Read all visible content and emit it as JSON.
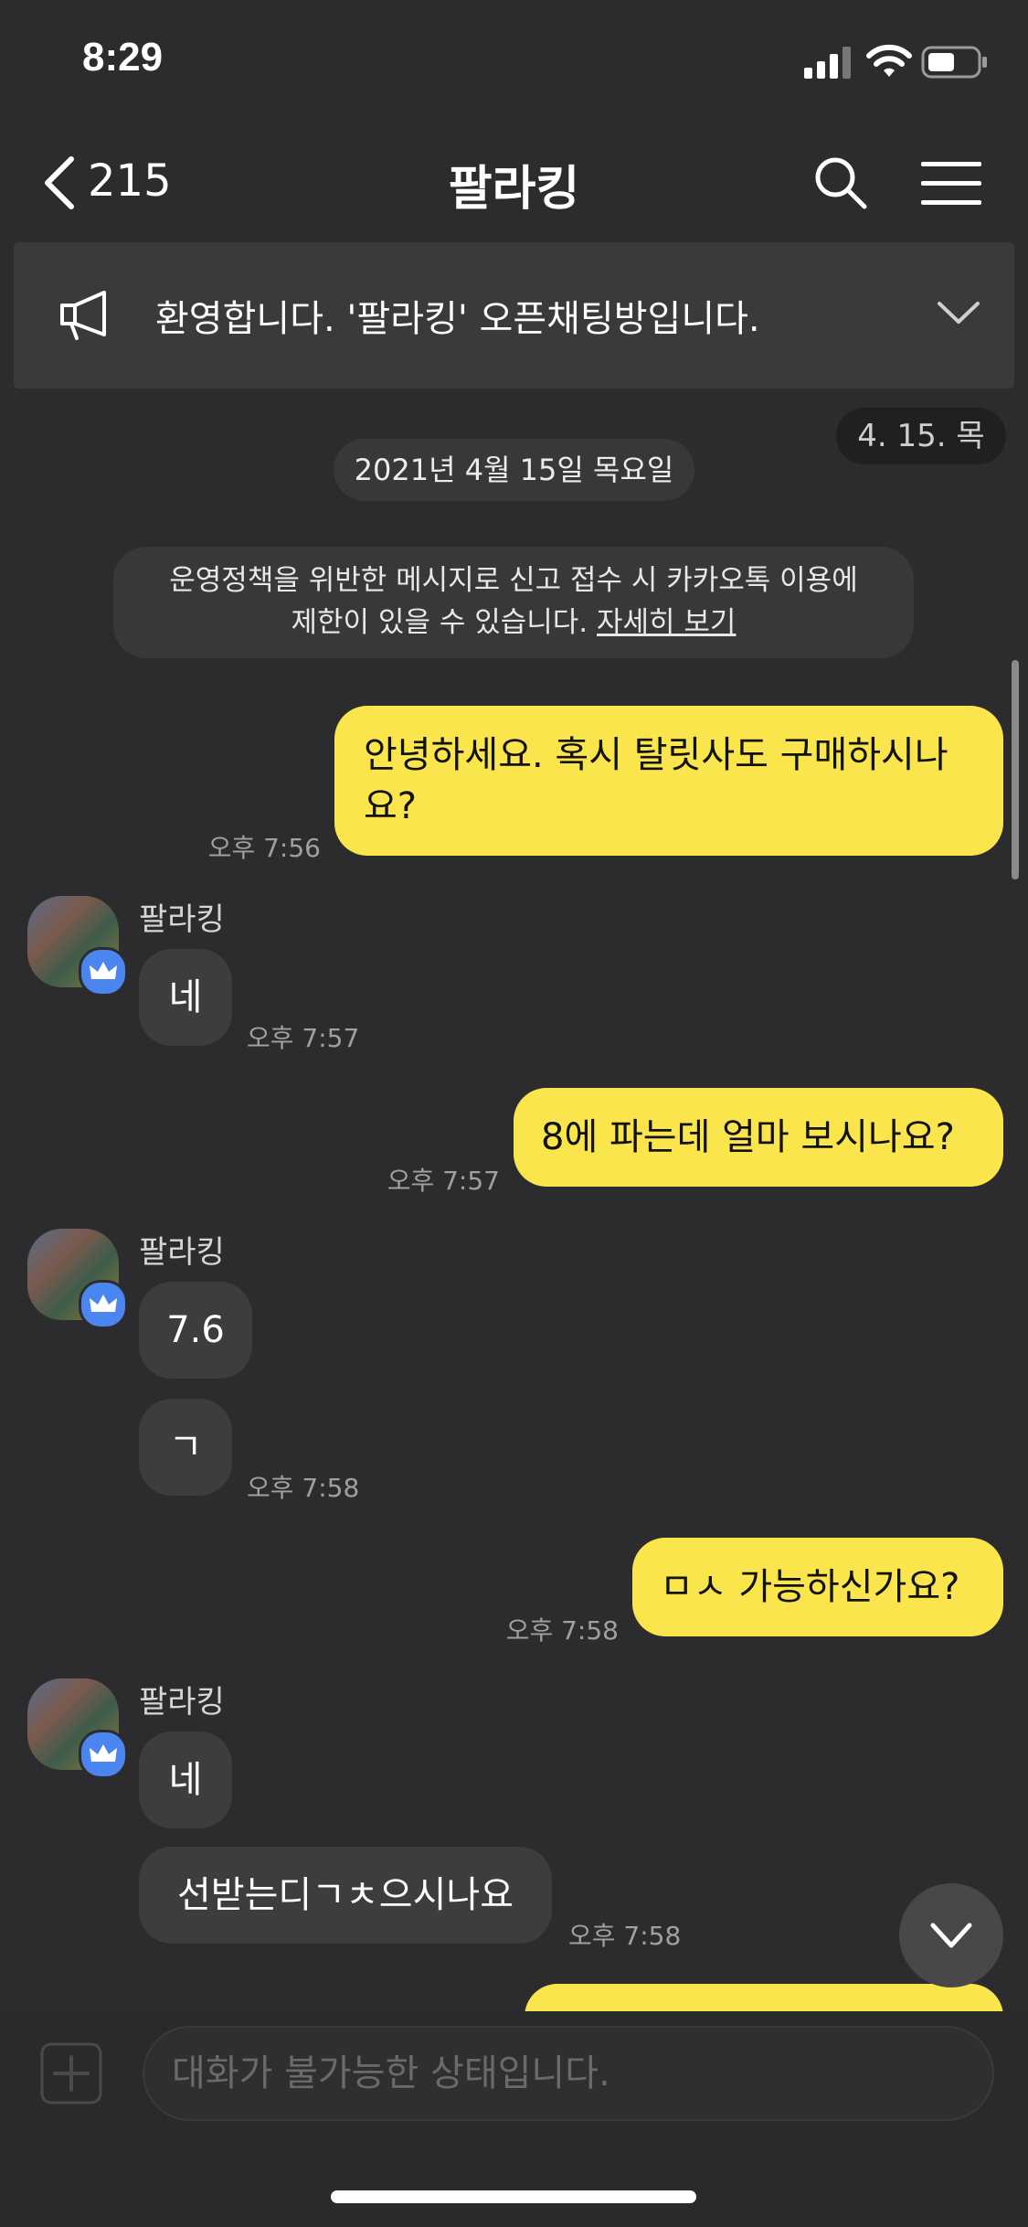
{
  "status_bar": {
    "time": "8:29"
  },
  "header": {
    "back_count": "215",
    "title": "팔라킹"
  },
  "notice": {
    "text": "환영합니다. '팔라킹' 오픈채팅방입니다."
  },
  "date_float": "4. 15. 목",
  "date_divider": "2021년 4월 15일 목요일",
  "policy": {
    "line1": "운영정책을 위반한 메시지로 신고 접수 시 카카오톡 이용에",
    "line2_prefix": "제한이 있을 수 있습니다. ",
    "link": "자세히 보기"
  },
  "sender_name": "팔라킹",
  "messages": [
    {
      "from": "me",
      "lines": [
        "안녕하세요. 혹시 탈릿사도 구매하시나",
        "요?"
      ],
      "time": "오후 7:56"
    },
    {
      "from": "other",
      "text": "네",
      "time": "오후 7:57"
    },
    {
      "from": "me",
      "text": "8에 파는데 얼마 보시나요?",
      "time": "오후 7:57"
    },
    {
      "from": "other",
      "text": "7.6"
    },
    {
      "from": "other",
      "text": "ㄱ",
      "time": "오후 7:58"
    },
    {
      "from": "me",
      "text": "ㅁㅅ 가능하신가요?",
      "time": "오후 7:58"
    },
    {
      "from": "other",
      "text": "네"
    },
    {
      "from": "other",
      "text": "선받는디ㄱㅊ으시나요",
      "time": "오후 7:58"
    }
  ],
  "input": {
    "placeholder": "대화가 불가능한 상태입니다."
  },
  "colors": {
    "background": "#2c2c2e",
    "my_bubble": "#fae54d",
    "other_bubble": "#3d3d40",
    "crown_badge": "#4b86f0"
  }
}
